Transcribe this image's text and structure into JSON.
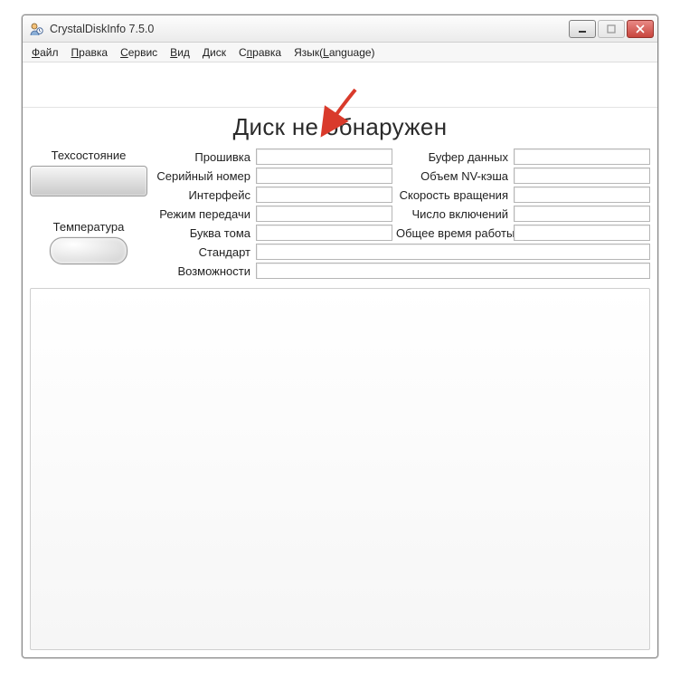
{
  "window": {
    "title": "CrystalDiskInfo 7.5.0"
  },
  "menu": {
    "file": {
      "pre": "",
      "ul": "Ф",
      "post": "айл"
    },
    "edit": {
      "pre": "",
      "ul": "П",
      "post": "равка"
    },
    "service": {
      "pre": "",
      "ul": "С",
      "post": "ервис"
    },
    "view": {
      "pre": "",
      "ul": "В",
      "post": "ид"
    },
    "disk": {
      "pre": "",
      "ul": "Д",
      "post": "иск"
    },
    "help": {
      "pre": "С",
      "ul": "п",
      "post": "равка"
    },
    "lang": {
      "pre": "Язык(",
      "ul": "L",
      "post": "anguage)"
    }
  },
  "status": {
    "headline": "Диск не обнаружен",
    "health_label": "Техсостояние",
    "temp_label": "Температура"
  },
  "fields": {
    "firmware": {
      "label": "Прошивка",
      "value": ""
    },
    "serial": {
      "label": "Серийный номер",
      "value": ""
    },
    "interface": {
      "label": "Интерфейс",
      "value": ""
    },
    "transfer": {
      "label": "Режим передачи",
      "value": ""
    },
    "drive_letter": {
      "label": "Буква тома",
      "value": ""
    },
    "standard": {
      "label": "Стандарт",
      "value": ""
    },
    "features": {
      "label": "Возможности",
      "value": ""
    },
    "buffer": {
      "label": "Буфер данных",
      "value": ""
    },
    "nvcache": {
      "label": "Объем NV-кэша",
      "value": ""
    },
    "rpm": {
      "label": "Скорость вращения",
      "value": ""
    },
    "power_count": {
      "label": "Число включений",
      "value": ""
    },
    "power_hours": {
      "label": "Общее время работы",
      "value": ""
    }
  }
}
